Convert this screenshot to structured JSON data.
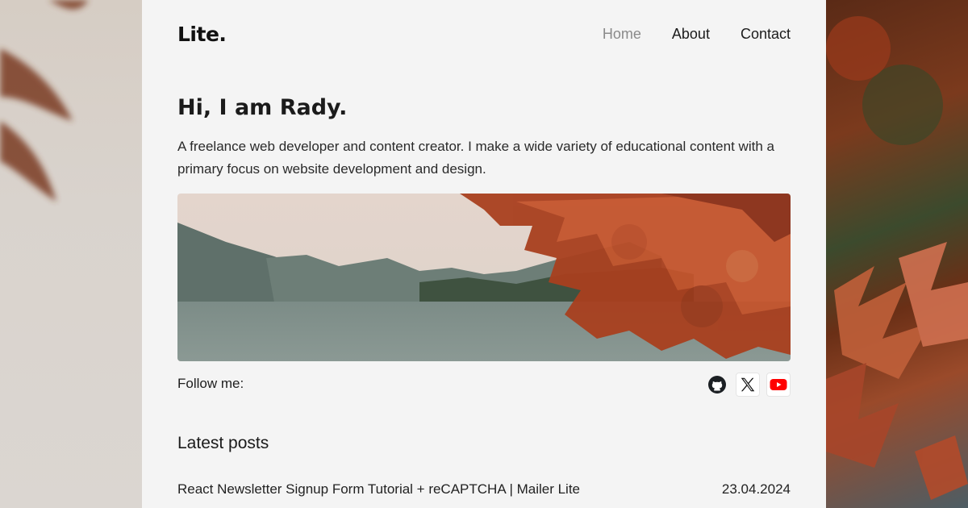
{
  "site": {
    "logo": "Lite."
  },
  "nav": {
    "items": [
      {
        "label": "Home",
        "active": true
      },
      {
        "label": "About",
        "active": false
      },
      {
        "label": "Contact",
        "active": false
      }
    ]
  },
  "hero": {
    "title": "Hi, I am Rady.",
    "description": "A freelance web developer and content creator. I make a wide variety of educational content with a primary focus on website development and design."
  },
  "follow": {
    "label": "Follow me:",
    "icons": [
      "github-icon",
      "x-icon",
      "youtube-icon"
    ]
  },
  "posts": {
    "title": "Latest posts",
    "items": [
      {
        "title": "React Newsletter Signup Form Tutorial + reCAPTCHA | Mailer Lite",
        "date": "23.04.2024"
      }
    ]
  },
  "colors": {
    "card_bg": "#f4f4f4",
    "text": "#1b1b1b",
    "nav_active": "#8a8a8a",
    "youtube_red": "#ff0000"
  }
}
